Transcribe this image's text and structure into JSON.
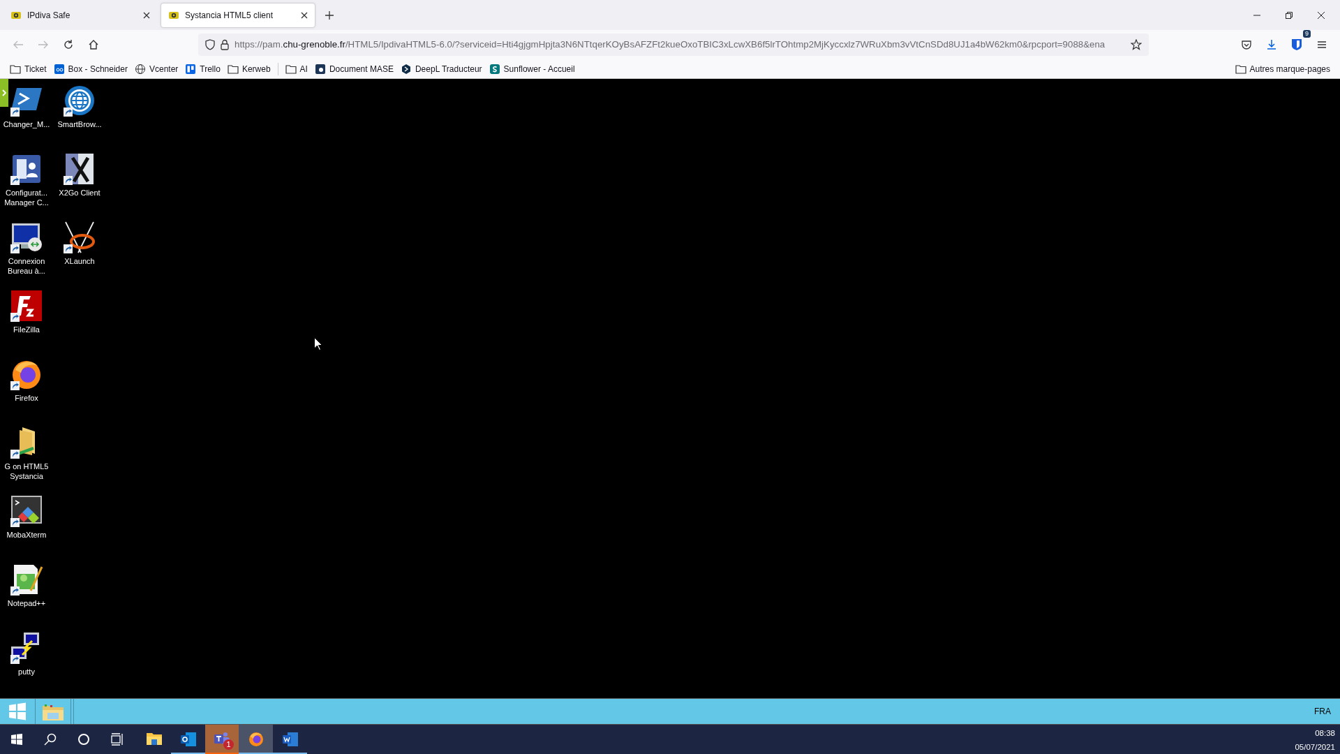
{
  "browser": {
    "tabs": [
      {
        "title": "IPdiva Safe",
        "selected": false
      },
      {
        "title": "Systancia HTML5 client",
        "selected": true
      }
    ],
    "navigation": [
      {
        "disabled": true
      },
      {
        "disabled": true
      },
      {
        "disabled": false
      },
      {
        "disabled": false
      }
    ],
    "address": {
      "prefix": "https://pam.",
      "host": "chu-grenoble.fr",
      "rest": "/HTML5/IpdivaHTML5-6.0/?serviceid=Hti4gjgmHpjta3N6NTtqerKOyBsAFZFt2kueOxoTBIC3xLcwXB6f5lrTOhtmp2MjKyccxlz7WRuXbm3vVtCnSDd8UJ1a4bW62km0&rpcport=9088&ena"
    },
    "extension_badge": "9",
    "bookmark_groups": [
      [
        {
          "label": "Ticket"
        },
        {
          "label": "Box - Schneider"
        },
        {
          "label": "Vcenter"
        },
        {
          "label": "Trello"
        },
        {
          "label": "Kerweb"
        }
      ],
      [
        {
          "label": "AI"
        },
        {
          "label": "Document MASE"
        },
        {
          "label": "DeepL Traducteur"
        },
        {
          "label": "Sunflower - Accueil"
        }
      ]
    ],
    "other_bookmarks": "Autres marque-pages"
  },
  "remote_desktop": {
    "icons": [
      {
        "lines": [
          "Changer_M..."
        ]
      },
      {
        "lines": [
          "Configurat...",
          "Manager C..."
        ]
      },
      {
        "lines": [
          "Connexion",
          "Bureau à..."
        ]
      },
      {
        "lines": [
          "FileZilla"
        ]
      },
      {
        "lines": [
          "Firefox"
        ]
      },
      {
        "lines": [
          "G on HTML5",
          "Systancia"
        ]
      },
      {
        "lines": [
          "MobaXterm"
        ]
      },
      {
        "lines": [
          "Notepad++"
        ]
      },
      {
        "lines": [
          "putty"
        ]
      },
      {
        "lines": [
          "SmartBrow..."
        ]
      },
      {
        "lines": [
          "X2Go Client"
        ]
      },
      {
        "lines": [
          "XLaunch"
        ]
      }
    ],
    "taskbar": {
      "language": "FRA"
    }
  },
  "taskbar": {
    "apps": [
      {
        "running": false,
        "active": false,
        "flashing": false
      },
      {
        "running": true,
        "active": false,
        "flashing": false
      },
      {
        "running": true,
        "active": false,
        "flashing": true,
        "badge": "1"
      },
      {
        "running": true,
        "active": true,
        "flashing": false
      },
      {
        "running": true,
        "active": false,
        "flashing": false
      }
    ],
    "time": "08:38",
    "date": "05/07/2021"
  }
}
